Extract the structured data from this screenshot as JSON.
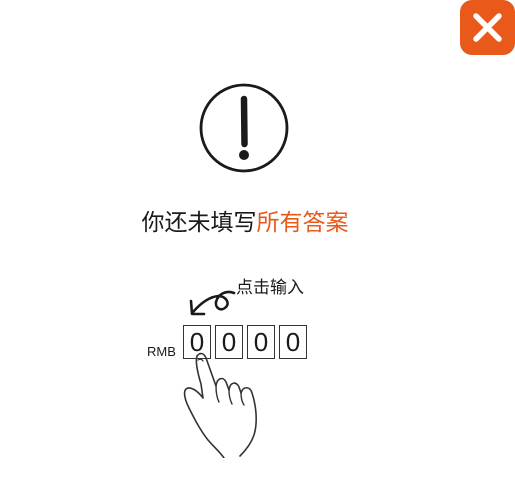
{
  "dialog": {
    "close_icon": "close-icon",
    "alert_icon": "exclamation-circle-icon",
    "message_prefix": "你还未填写",
    "message_highlight": "所有答案",
    "accent_color": "#e8591a"
  },
  "hint": {
    "label": "点击输入",
    "arrow_icon": "curved-arrow-icon",
    "hand_icon": "pointing-hand-icon"
  },
  "amount_input": {
    "currency": "RMB",
    "digits": [
      "0",
      "0",
      "0",
      "0"
    ]
  }
}
